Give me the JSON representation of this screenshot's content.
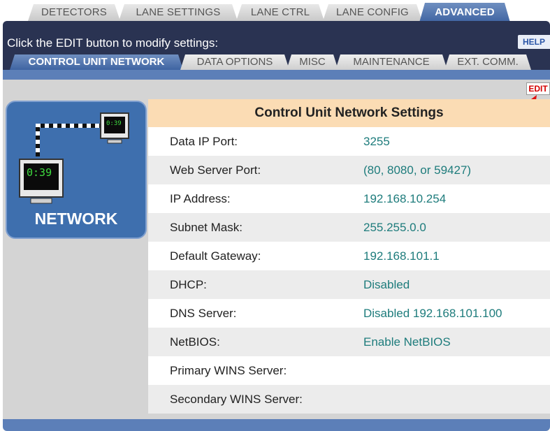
{
  "top_tabs": [
    {
      "label": "DETECTORS"
    },
    {
      "label": "LANE SETTINGS"
    },
    {
      "label": "LANE CTRL"
    },
    {
      "label": "LANE CONFIG"
    },
    {
      "label": "ADVANCED",
      "active": true
    }
  ],
  "header": {
    "instruction": "Click the EDIT button to modify settings:",
    "help_label": "HELP"
  },
  "sub_tabs": [
    {
      "label": "CONTROL UNIT NETWORK",
      "active": true
    },
    {
      "label": "DATA OPTIONS"
    },
    {
      "label": "MISC"
    },
    {
      "label": "MAINTENANCE"
    },
    {
      "label": "EXT. COMM."
    }
  ],
  "edit_label": "EDIT",
  "panel": {
    "label": "NETWORK",
    "monitor_time": "0:39",
    "monitor_small_time": "0:39"
  },
  "table": {
    "title": "Control Unit Network Settings",
    "rows": [
      {
        "label": "Data IP Port:",
        "value": "3255"
      },
      {
        "label": "Web Server Port:",
        "value": "(80, 8080, or 59427)"
      },
      {
        "label": "IP Address:",
        "value": "192.168.10.254"
      },
      {
        "label": "Subnet Mask:",
        "value": "255.255.0.0"
      },
      {
        "label": "Default Gateway:",
        "value": "192.168.101.1"
      },
      {
        "label": "DHCP:",
        "value": "Disabled"
      },
      {
        "label": "DNS Server:",
        "value": "Disabled 192.168.101.100"
      },
      {
        "label": "NetBIOS:",
        "value": "Enable NetBIOS"
      },
      {
        "label": "Primary WINS Server:",
        "value": ""
      },
      {
        "label": "Secondary WINS Server:",
        "value": ""
      }
    ]
  },
  "colors": {
    "header_dark": "#2a3352",
    "tab_active": "#3f64a2",
    "value_text": "#1e7c7c",
    "table_header": "#fbdcb4",
    "edit_red": "#d40000"
  }
}
